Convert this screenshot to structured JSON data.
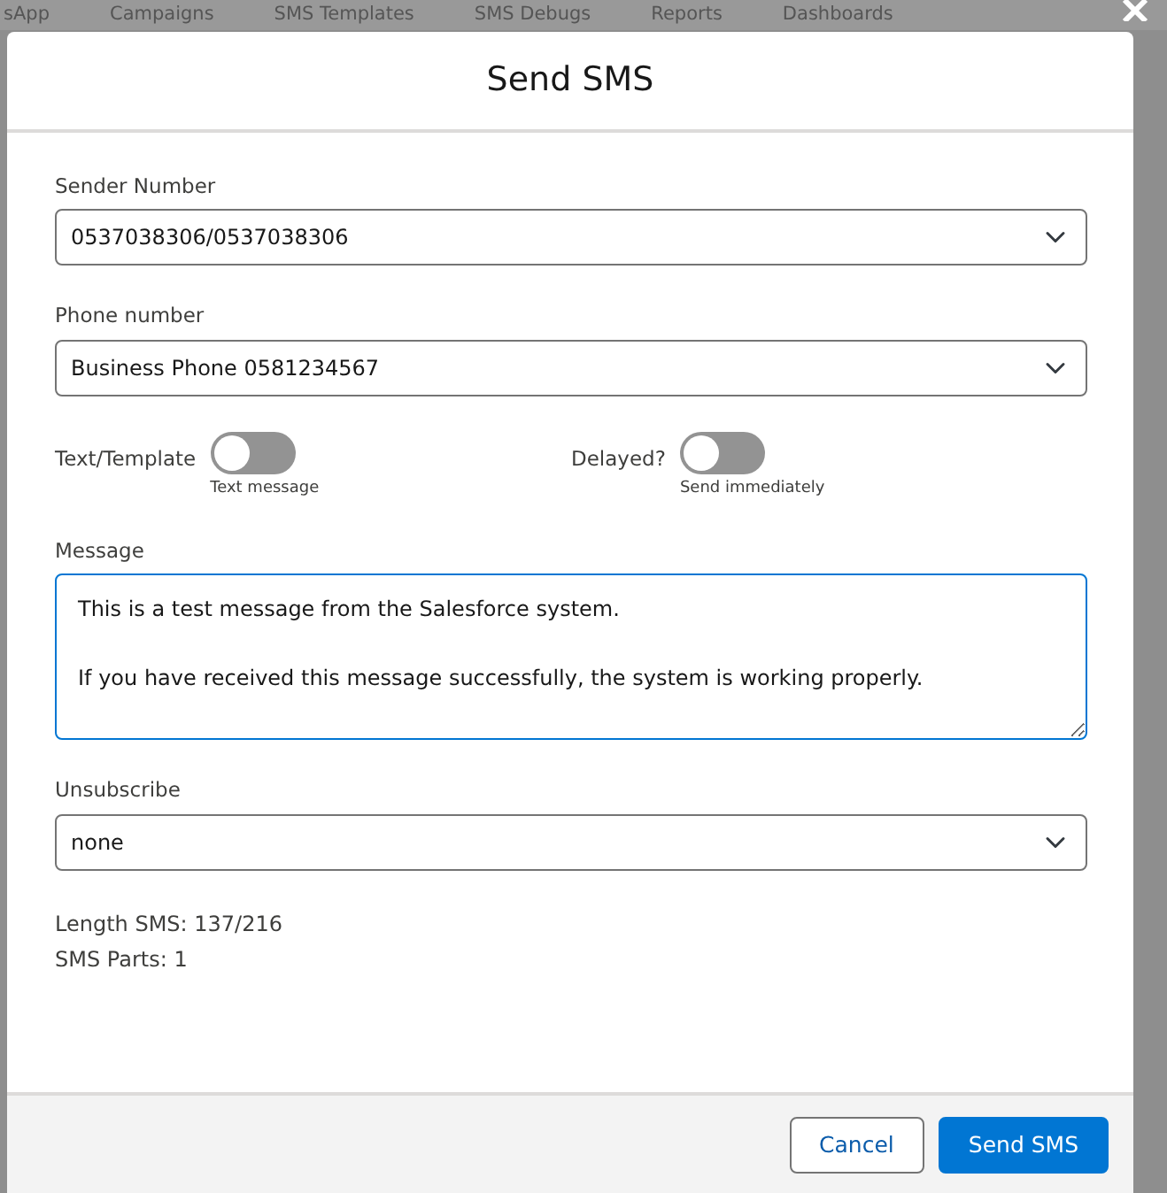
{
  "background_nav": [
    "sApp",
    "Campaigns",
    "SMS Templates",
    "SMS Debugs",
    "Reports",
    "Dashboards"
  ],
  "modal": {
    "title": "Send SMS",
    "sender_number": {
      "label": "Sender Number",
      "value": "0537038306/0537038306"
    },
    "phone_number": {
      "label": "Phone number",
      "value": "Business Phone 0581234567"
    },
    "toggles": [
      {
        "label": "Text/Template",
        "on": false,
        "caption": "Text message"
      },
      {
        "label": "Delayed?",
        "on": false,
        "caption": "Send immediately"
      }
    ],
    "message": {
      "label": "Message",
      "value": "This is a test message from the Salesforce system.\n\nIf you have received this message successfully, the system is working properly."
    },
    "unsubscribe": {
      "label": "Unsubscribe",
      "value": "none"
    },
    "stats": [
      "Length SMS: 137/216",
      "SMS Parts: 1"
    ],
    "buttons": [
      {
        "kind": "neutral",
        "label": "Cancel"
      },
      {
        "kind": "brand",
        "label": "Send SMS"
      }
    ]
  }
}
